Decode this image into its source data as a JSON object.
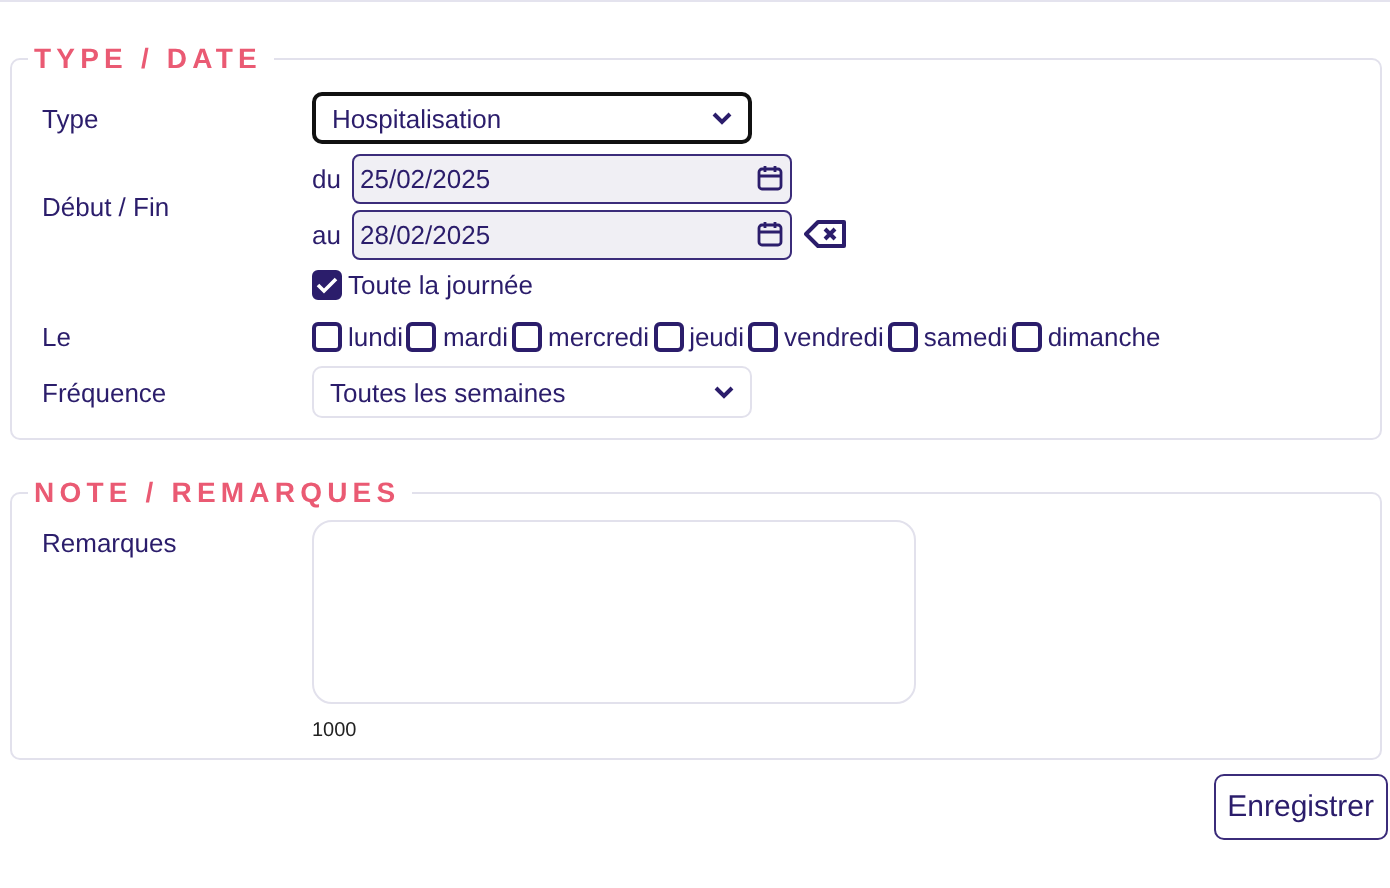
{
  "type_date": {
    "title": "TYPE / DATE",
    "type": {
      "label": "Type",
      "value": "Hospitalisation"
    },
    "period": {
      "label": "Début / Fin",
      "from_label": "du",
      "from": "25/02/2025",
      "to_label": "au",
      "to": "28/02/2025"
    },
    "all_day": {
      "label": "Toute la journée",
      "checked": true
    },
    "days": {
      "label": "Le",
      "items": [
        {
          "label": "lundi",
          "checked": false
        },
        {
          "label": "mardi",
          "checked": false
        },
        {
          "label": "mercredi",
          "checked": false
        },
        {
          "label": "jeudi",
          "checked": false
        },
        {
          "label": "vendredi",
          "checked": false
        },
        {
          "label": "samedi",
          "checked": false
        },
        {
          "label": "dimanche",
          "checked": false
        }
      ]
    },
    "frequency": {
      "label": "Fréquence",
      "value": "Toutes les semaines"
    }
  },
  "notes": {
    "title": "NOTE / REMARQUES",
    "label": "Remarques",
    "counter": "1000"
  },
  "save_button": "Enregistrer"
}
